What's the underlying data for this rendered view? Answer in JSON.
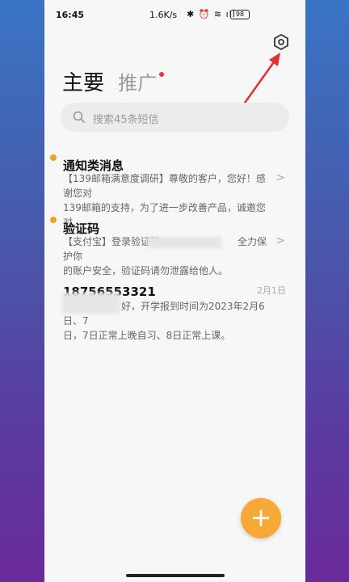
{
  "status_bar": {
    "time": "16:45",
    "speed": "1.6K/s",
    "battery": "98"
  },
  "tabs": {
    "main": "主要",
    "promo": "推广"
  },
  "search": {
    "placeholder": "搜索45条短信"
  },
  "messages": [
    {
      "sender": "通知类消息",
      "preview": "【139邮箱满意度调研】尊敬的客户，您好！感谢您对\n139邮箱的支持，为了进一步改善产品，诚邀您对…",
      "unread": true
    },
    {
      "sender": "验证码",
      "preview": "【支付宝】登录验证码　　　　　　　　全力保护你\n的账户安全，验证码请勿泄露给他人。",
      "unread": true
    },
    {
      "sender": "18756553321",
      "preview": "　　　　　　好，开学报到时间为2023年2月6日、7\n日，7日正常上晚自习、8日正常上课。",
      "date": "2月1日",
      "unread": false
    }
  ],
  "colors": {
    "accent": "#f7a938",
    "unread_dot": "#f0a030",
    "arrow": "#e03030"
  },
  "icons": [
    "settings-gear-icon",
    "search-icon",
    "chevron-right-icon",
    "plus-icon"
  ]
}
